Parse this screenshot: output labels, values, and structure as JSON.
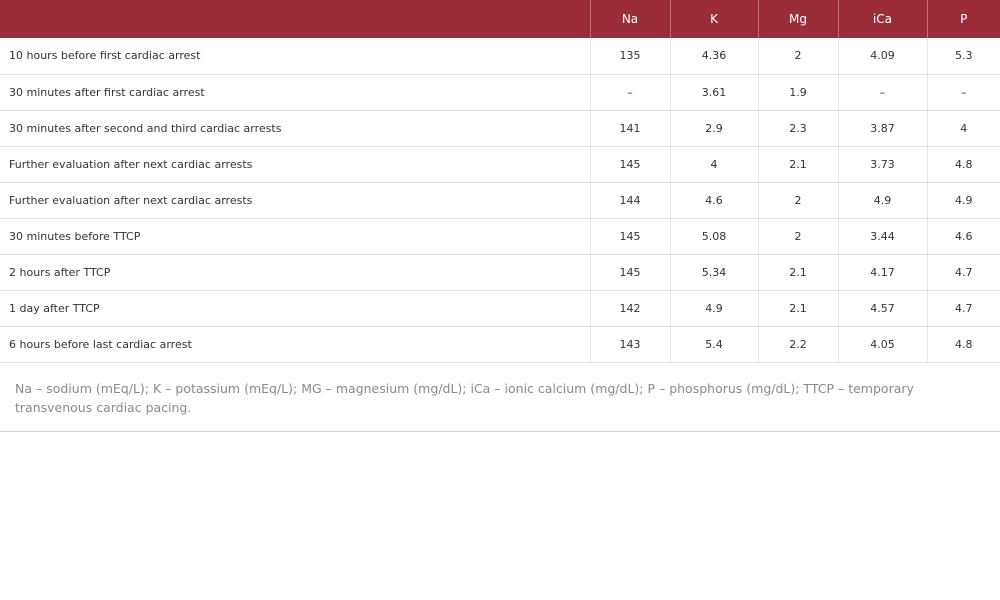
{
  "table": {
    "headers": [
      "",
      "Na",
      "K",
      "Mg",
      "iCa",
      "P"
    ],
    "rows": [
      [
        "10 hours before first cardiac arrest",
        "135",
        "4.36",
        "2",
        "4.09",
        "5.3"
      ],
      [
        "30 minutes after first cardiac arrest",
        "–",
        "3.61",
        "1.9",
        "–",
        "–"
      ],
      [
        "30 minutes after second and third cardiac arrests",
        "141",
        "2.9",
        "2.3",
        "3.87",
        "4"
      ],
      [
        "Further evaluation after next cardiac arrests",
        "145",
        "4",
        "2.1",
        "3.73",
        "4.8"
      ],
      [
        "Further evaluation after next cardiac arrests",
        "144",
        "4.6",
        "2",
        "4.9",
        "4.9"
      ],
      [
        "30 minutes before TTCP",
        "145",
        "5.08",
        "2",
        "3.44",
        "4.6"
      ],
      [
        "2 hours after TTCP",
        "145",
        "5.34",
        "2.1",
        "4.17",
        "4.7"
      ],
      [
        "1 day after TTCP",
        "142",
        "4.9",
        "2.1",
        "4.57",
        "4.7"
      ],
      [
        "6 hours before last cardiac arrest",
        "143",
        "5.4",
        "2.2",
        "4.05",
        "4.8"
      ]
    ]
  },
  "footnote": "Na – sodium (mEq/L); K – potassium (mEq/L); MG – magnesium (mg/dL); iCa – ionic calcium (mg/dL); P – phosphorus (mg/dL); TTCP – temporary transvenous cardiac pacing.",
  "colors": {
    "header_bg": "#9b2d3b",
    "header_text": "#ffffff",
    "footnote_text": "#8a8a8a"
  }
}
